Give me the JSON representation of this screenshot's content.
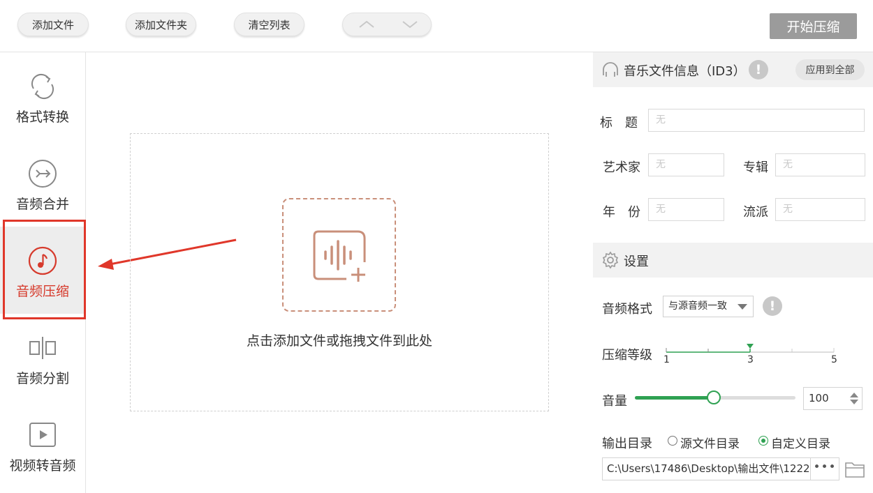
{
  "toolbar": {
    "add_file": "添加文件",
    "add_folder": "添加文件夹",
    "clear_list": "清空列表",
    "move_up_icon": "chevron-up-icon",
    "move_down_icon": "chevron-down-icon",
    "start_compress": "开始压缩"
  },
  "sidebar": {
    "items": [
      {
        "label": "格式转换",
        "icon": "refresh-icon"
      },
      {
        "label": "音频合并",
        "icon": "merge-icon"
      },
      {
        "label": "音频压缩",
        "icon": "music-note-icon",
        "active": true
      },
      {
        "label": "音频分割",
        "icon": "split-icon"
      },
      {
        "label": "视频转音频",
        "icon": "play-icon"
      }
    ]
  },
  "dropzone": {
    "hint": "点击添加文件或拖拽文件到此处",
    "icon": "audio-add-icon"
  },
  "id3": {
    "title": "音乐文件信息（ID3）",
    "apply_all": "应用到全部",
    "fields": {
      "title_label": "标　题",
      "title_placeholder": "无",
      "artist_label": "艺术家",
      "artist_placeholder": "无",
      "album_label": "专辑",
      "album_placeholder": "无",
      "year_label": "年　份",
      "year_placeholder": "无",
      "genre_label": "流派",
      "genre_placeholder": "无"
    }
  },
  "settings": {
    "title": "设置",
    "audio_format_label": "音频格式",
    "audio_format_value": "与源音频一致",
    "compress_level_label": "压缩等级",
    "compress_level": {
      "min": "1",
      "mid": "3",
      "max": "5",
      "value": 3
    },
    "volume_label": "音量",
    "volume_value": "100",
    "volume_fraction": 0.49,
    "output_dir_label": "输出目录",
    "output_options": [
      "源文件目录",
      "自定义目录"
    ],
    "output_selected": 1,
    "output_path": "C:\\Users\\17486\\Desktop\\输出文件\\1222.",
    "browse_dots": "•••"
  },
  "colors": {
    "accent": "#2fa152",
    "active": "#d63a2c",
    "annotation": "#e0372a",
    "drop_icon": "#c98f7a"
  }
}
